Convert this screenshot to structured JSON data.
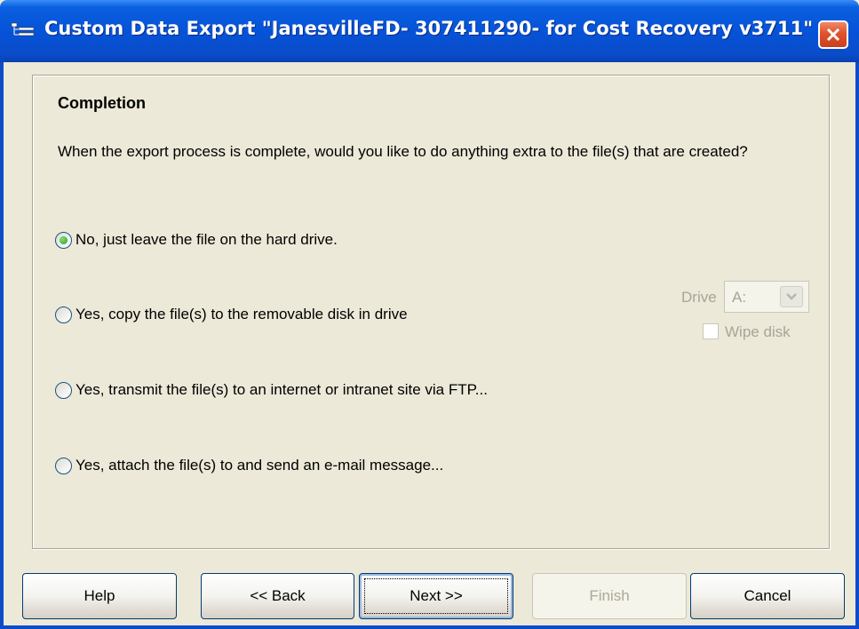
{
  "window": {
    "title": "Custom Data Export \"JanesvilleFD- 307411290- for Cost Recovery v3711\"",
    "icon": "export-app-icon",
    "close_icon": "close-icon"
  },
  "page": {
    "heading": "Completion",
    "question": "When the export process is complete, would you like to do anything extra to the file(s) that are created?"
  },
  "options": [
    {
      "label": "No, just leave the file on the hard drive.",
      "checked": true
    },
    {
      "label": "Yes, copy the file(s) to the removable disk in drive",
      "checked": false
    },
    {
      "label": "Yes, transmit the file(s) to an internet or intranet site via FTP...",
      "checked": false
    },
    {
      "label": "Yes, attach the file(s) to and send an e-mail message...",
      "checked": false
    }
  ],
  "drive": {
    "label": "Drive",
    "value": "A:",
    "wipe_label": "Wipe disk"
  },
  "buttons": {
    "help": "Help",
    "back": "<< Back",
    "next": "Next >>",
    "finish": "Finish",
    "cancel": "Cancel"
  },
  "colors": {
    "titlebar": "#0653d8",
    "window_bg": "#ece9d8",
    "disabled_text": "#a7a49a"
  }
}
